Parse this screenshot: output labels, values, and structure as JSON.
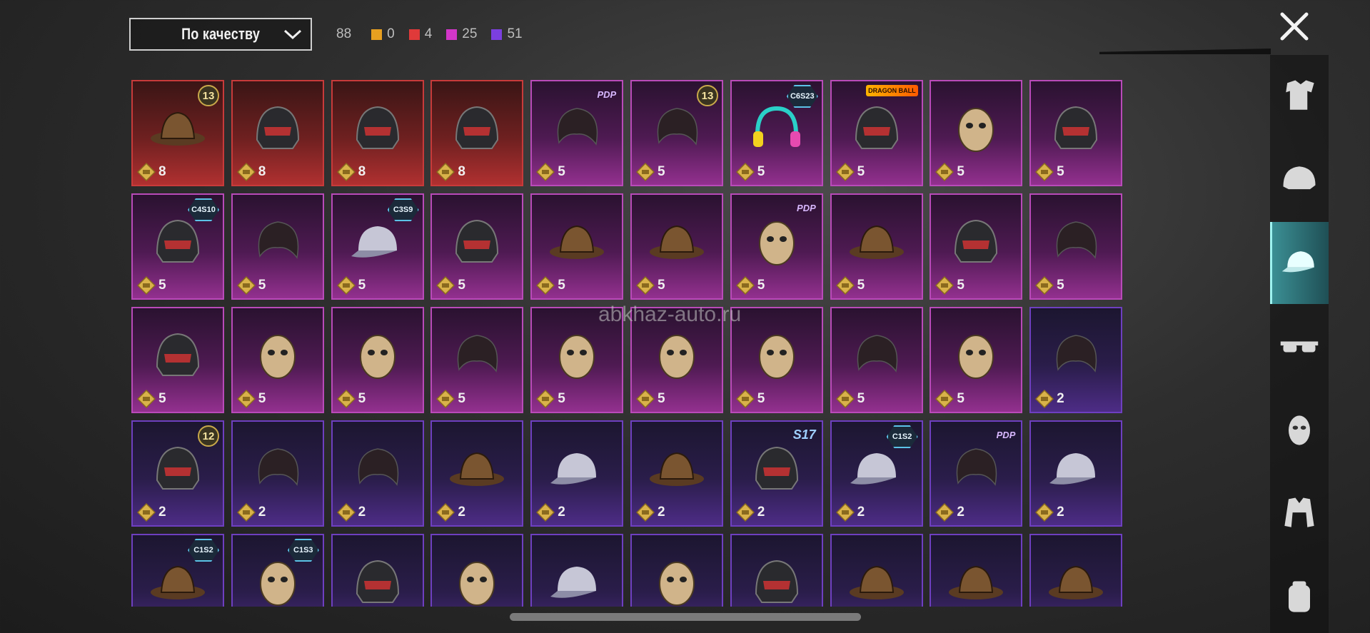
{
  "sort": {
    "label": "По качеству"
  },
  "counts": {
    "total": "88",
    "items": [
      {
        "value": "0",
        "color": "#e8a020"
      },
      {
        "value": "4",
        "color": "#e03a3a"
      },
      {
        "value": "25",
        "color": "#d236c8"
      },
      {
        "value": "51",
        "color": "#7b3fe0"
      }
    ]
  },
  "watermark": "abkhaz-auto.ru",
  "sidebar": [
    "outfit-icon",
    "helmet-icon",
    "cap-icon",
    "glasses-icon",
    "mask-icon",
    "jacket-icon",
    "backpack-icon"
  ],
  "items": [
    {
      "q": "red",
      "price": "8",
      "badge": "13",
      "btype": "num",
      "art": "hat"
    },
    {
      "q": "red",
      "price": "8",
      "badge": "",
      "btype": "",
      "art": "helmet"
    },
    {
      "q": "red",
      "price": "8",
      "badge": "",
      "btype": "",
      "art": "helmet"
    },
    {
      "q": "red",
      "price": "8",
      "badge": "",
      "btype": "",
      "art": "helmet"
    },
    {
      "q": "pink",
      "price": "5",
      "badge": "PDP",
      "btype": "tag",
      "art": "hair"
    },
    {
      "q": "pink",
      "price": "5",
      "badge": "13",
      "btype": "num",
      "art": "hair"
    },
    {
      "q": "pink",
      "price": "5",
      "badge": "C6S23",
      "btype": "season",
      "art": "headphones"
    },
    {
      "q": "pink",
      "price": "5",
      "badge": "DRAGON BALL",
      "btype": "logo",
      "art": "helmet"
    },
    {
      "q": "pink",
      "price": "5",
      "badge": "",
      "btype": "",
      "art": "mask"
    },
    {
      "q": "pink",
      "price": "5",
      "badge": "",
      "btype": "",
      "art": "helmet"
    },
    {
      "q": "pink",
      "price": "5",
      "badge": "C4S10",
      "btype": "season",
      "art": "helmet"
    },
    {
      "q": "pink",
      "price": "5",
      "badge": "",
      "btype": "",
      "art": "hair"
    },
    {
      "q": "pink",
      "price": "5",
      "badge": "C3S9",
      "btype": "season",
      "art": "cap"
    },
    {
      "q": "pink",
      "price": "5",
      "badge": "",
      "btype": "",
      "art": "helmet"
    },
    {
      "q": "pink",
      "price": "5",
      "badge": "",
      "btype": "",
      "art": "hat"
    },
    {
      "q": "pink",
      "price": "5",
      "badge": "",
      "btype": "",
      "art": "hat"
    },
    {
      "q": "pink",
      "price": "5",
      "badge": "PDP",
      "btype": "tag",
      "art": "mask"
    },
    {
      "q": "pink",
      "price": "5",
      "badge": "",
      "btype": "",
      "art": "hat"
    },
    {
      "q": "pink",
      "price": "5",
      "badge": "",
      "btype": "",
      "art": "helmet"
    },
    {
      "q": "pink",
      "price": "5",
      "badge": "",
      "btype": "",
      "art": "hair"
    },
    {
      "q": "pink",
      "price": "5",
      "badge": "",
      "btype": "",
      "art": "helmet"
    },
    {
      "q": "pink",
      "price": "5",
      "badge": "",
      "btype": "",
      "art": "mask"
    },
    {
      "q": "pink",
      "price": "5",
      "badge": "",
      "btype": "",
      "art": "mask"
    },
    {
      "q": "pink",
      "price": "5",
      "badge": "",
      "btype": "",
      "art": "hair"
    },
    {
      "q": "pink",
      "price": "5",
      "badge": "",
      "btype": "",
      "art": "mask"
    },
    {
      "q": "pink",
      "price": "5",
      "badge": "",
      "btype": "",
      "art": "mask"
    },
    {
      "q": "pink",
      "price": "5",
      "badge": "",
      "btype": "",
      "art": "mask"
    },
    {
      "q": "pink",
      "price": "5",
      "badge": "",
      "btype": "",
      "art": "hair"
    },
    {
      "q": "pink",
      "price": "5",
      "badge": "",
      "btype": "",
      "art": "mask"
    },
    {
      "q": "purple",
      "price": "2",
      "badge": "",
      "btype": "",
      "art": "hair"
    },
    {
      "q": "purple",
      "price": "2",
      "badge": "12",
      "btype": "num",
      "art": "helmet"
    },
    {
      "q": "purple",
      "price": "2",
      "badge": "",
      "btype": "",
      "art": "hair"
    },
    {
      "q": "purple",
      "price": "2",
      "badge": "",
      "btype": "",
      "art": "hair"
    },
    {
      "q": "purple",
      "price": "2",
      "badge": "",
      "btype": "",
      "art": "hat"
    },
    {
      "q": "purple",
      "price": "2",
      "badge": "",
      "btype": "",
      "art": "cap"
    },
    {
      "q": "purple",
      "price": "2",
      "badge": "",
      "btype": "",
      "art": "hat"
    },
    {
      "q": "purple",
      "price": "2",
      "badge": "S17",
      "btype": "s17",
      "art": "helmet"
    },
    {
      "q": "purple",
      "price": "2",
      "badge": "C1S2",
      "btype": "season",
      "art": "cap"
    },
    {
      "q": "purple",
      "price": "2",
      "badge": "PDP",
      "btype": "tag",
      "art": "hair"
    },
    {
      "q": "purple",
      "price": "2",
      "badge": "",
      "btype": "",
      "art": "cap"
    },
    {
      "q": "purple",
      "price": "",
      "badge": "C1S2",
      "btype": "season",
      "art": "hat"
    },
    {
      "q": "purple",
      "price": "",
      "badge": "C1S3",
      "btype": "season",
      "art": "mask"
    },
    {
      "q": "purple",
      "price": "",
      "badge": "",
      "btype": "",
      "art": "helmet"
    },
    {
      "q": "purple",
      "price": "",
      "badge": "",
      "btype": "",
      "art": "mask"
    },
    {
      "q": "purple",
      "price": "",
      "badge": "",
      "btype": "",
      "art": "cap"
    },
    {
      "q": "purple",
      "price": "",
      "badge": "",
      "btype": "",
      "art": "mask"
    },
    {
      "q": "purple",
      "price": "",
      "badge": "",
      "btype": "",
      "art": "helmet"
    },
    {
      "q": "purple",
      "price": "",
      "badge": "",
      "btype": "",
      "art": "hat"
    },
    {
      "q": "purple",
      "price": "",
      "badge": "",
      "btype": "",
      "art": "hat"
    },
    {
      "q": "purple",
      "price": "",
      "badge": "",
      "btype": "",
      "art": "hat"
    }
  ]
}
